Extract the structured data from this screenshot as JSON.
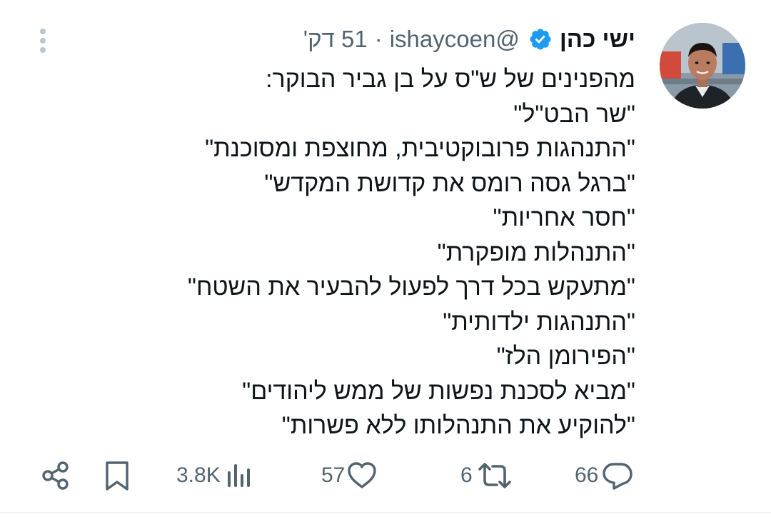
{
  "tweet": {
    "author": {
      "display_name": "ישי כהן",
      "handle": "@ishaycoen",
      "verified_icon": "verified-badge-icon",
      "avatar": "avatar"
    },
    "separator": "·",
    "time": "51 דק'",
    "text_lines": [
      "מהפנינים של ש\"ס על בן גביר הבוקר:",
      "\"שר הבט\"ל\"",
      "\"התנהגות פרובוקטיבית, מחוצפת ומסוכנת\"",
      "\"ברגל גסה רומס את קדושת המקדש\"",
      "\"חסר אחריות\"",
      "\"התנהלות מופקרת\"",
      "\"מתעקש בכל דרך לפעול להבעיר את השטח\"",
      "\"התנהגות ילדותית\"",
      "\"הפירומן הלז\"",
      "\"מביא לסכנת נפשות של ממש ליהודים\"",
      "\"להוקיע את התנהלותו ללא פשרות\""
    ],
    "actions": {
      "share": {
        "icon": "share-icon"
      },
      "bookmark": {
        "icon": "bookmark-icon"
      },
      "views": {
        "icon": "views-icon",
        "count": "3.8K"
      },
      "like": {
        "icon": "heart-icon",
        "count": "57"
      },
      "retweet": {
        "icon": "retweet-icon",
        "count": "6"
      },
      "reply": {
        "icon": "reply-icon",
        "count": "66"
      }
    },
    "more_icon": "more-vertical-icon"
  },
  "colors": {
    "text_primary": "#0f1419",
    "text_secondary": "#536471",
    "verified_blue": "#1d9bf0",
    "divider": "#eff3f4"
  }
}
